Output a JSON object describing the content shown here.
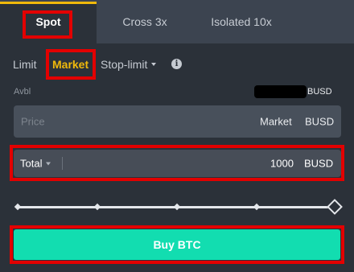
{
  "tabs": [
    {
      "label": "Spot"
    },
    {
      "label": "Cross 3x"
    },
    {
      "label": "Isolated 10x"
    }
  ],
  "order_types": {
    "limit": "Limit",
    "market": "Market",
    "stop_limit": "Stop-limit"
  },
  "info_icon": "i",
  "available": {
    "label": "Avbl",
    "unit": "BUSD"
  },
  "price_field": {
    "placeholder": "Price",
    "value": "Market",
    "unit": "BUSD"
  },
  "total_field": {
    "label": "Total",
    "value": "1000",
    "unit": "BUSD"
  },
  "slider": {
    "fraction": 1.0
  },
  "buy_button": {
    "label": "Buy BTC"
  },
  "colors": {
    "accent": "#f0b90b",
    "buy": "#12ddb0",
    "highlight": "#e30000"
  }
}
